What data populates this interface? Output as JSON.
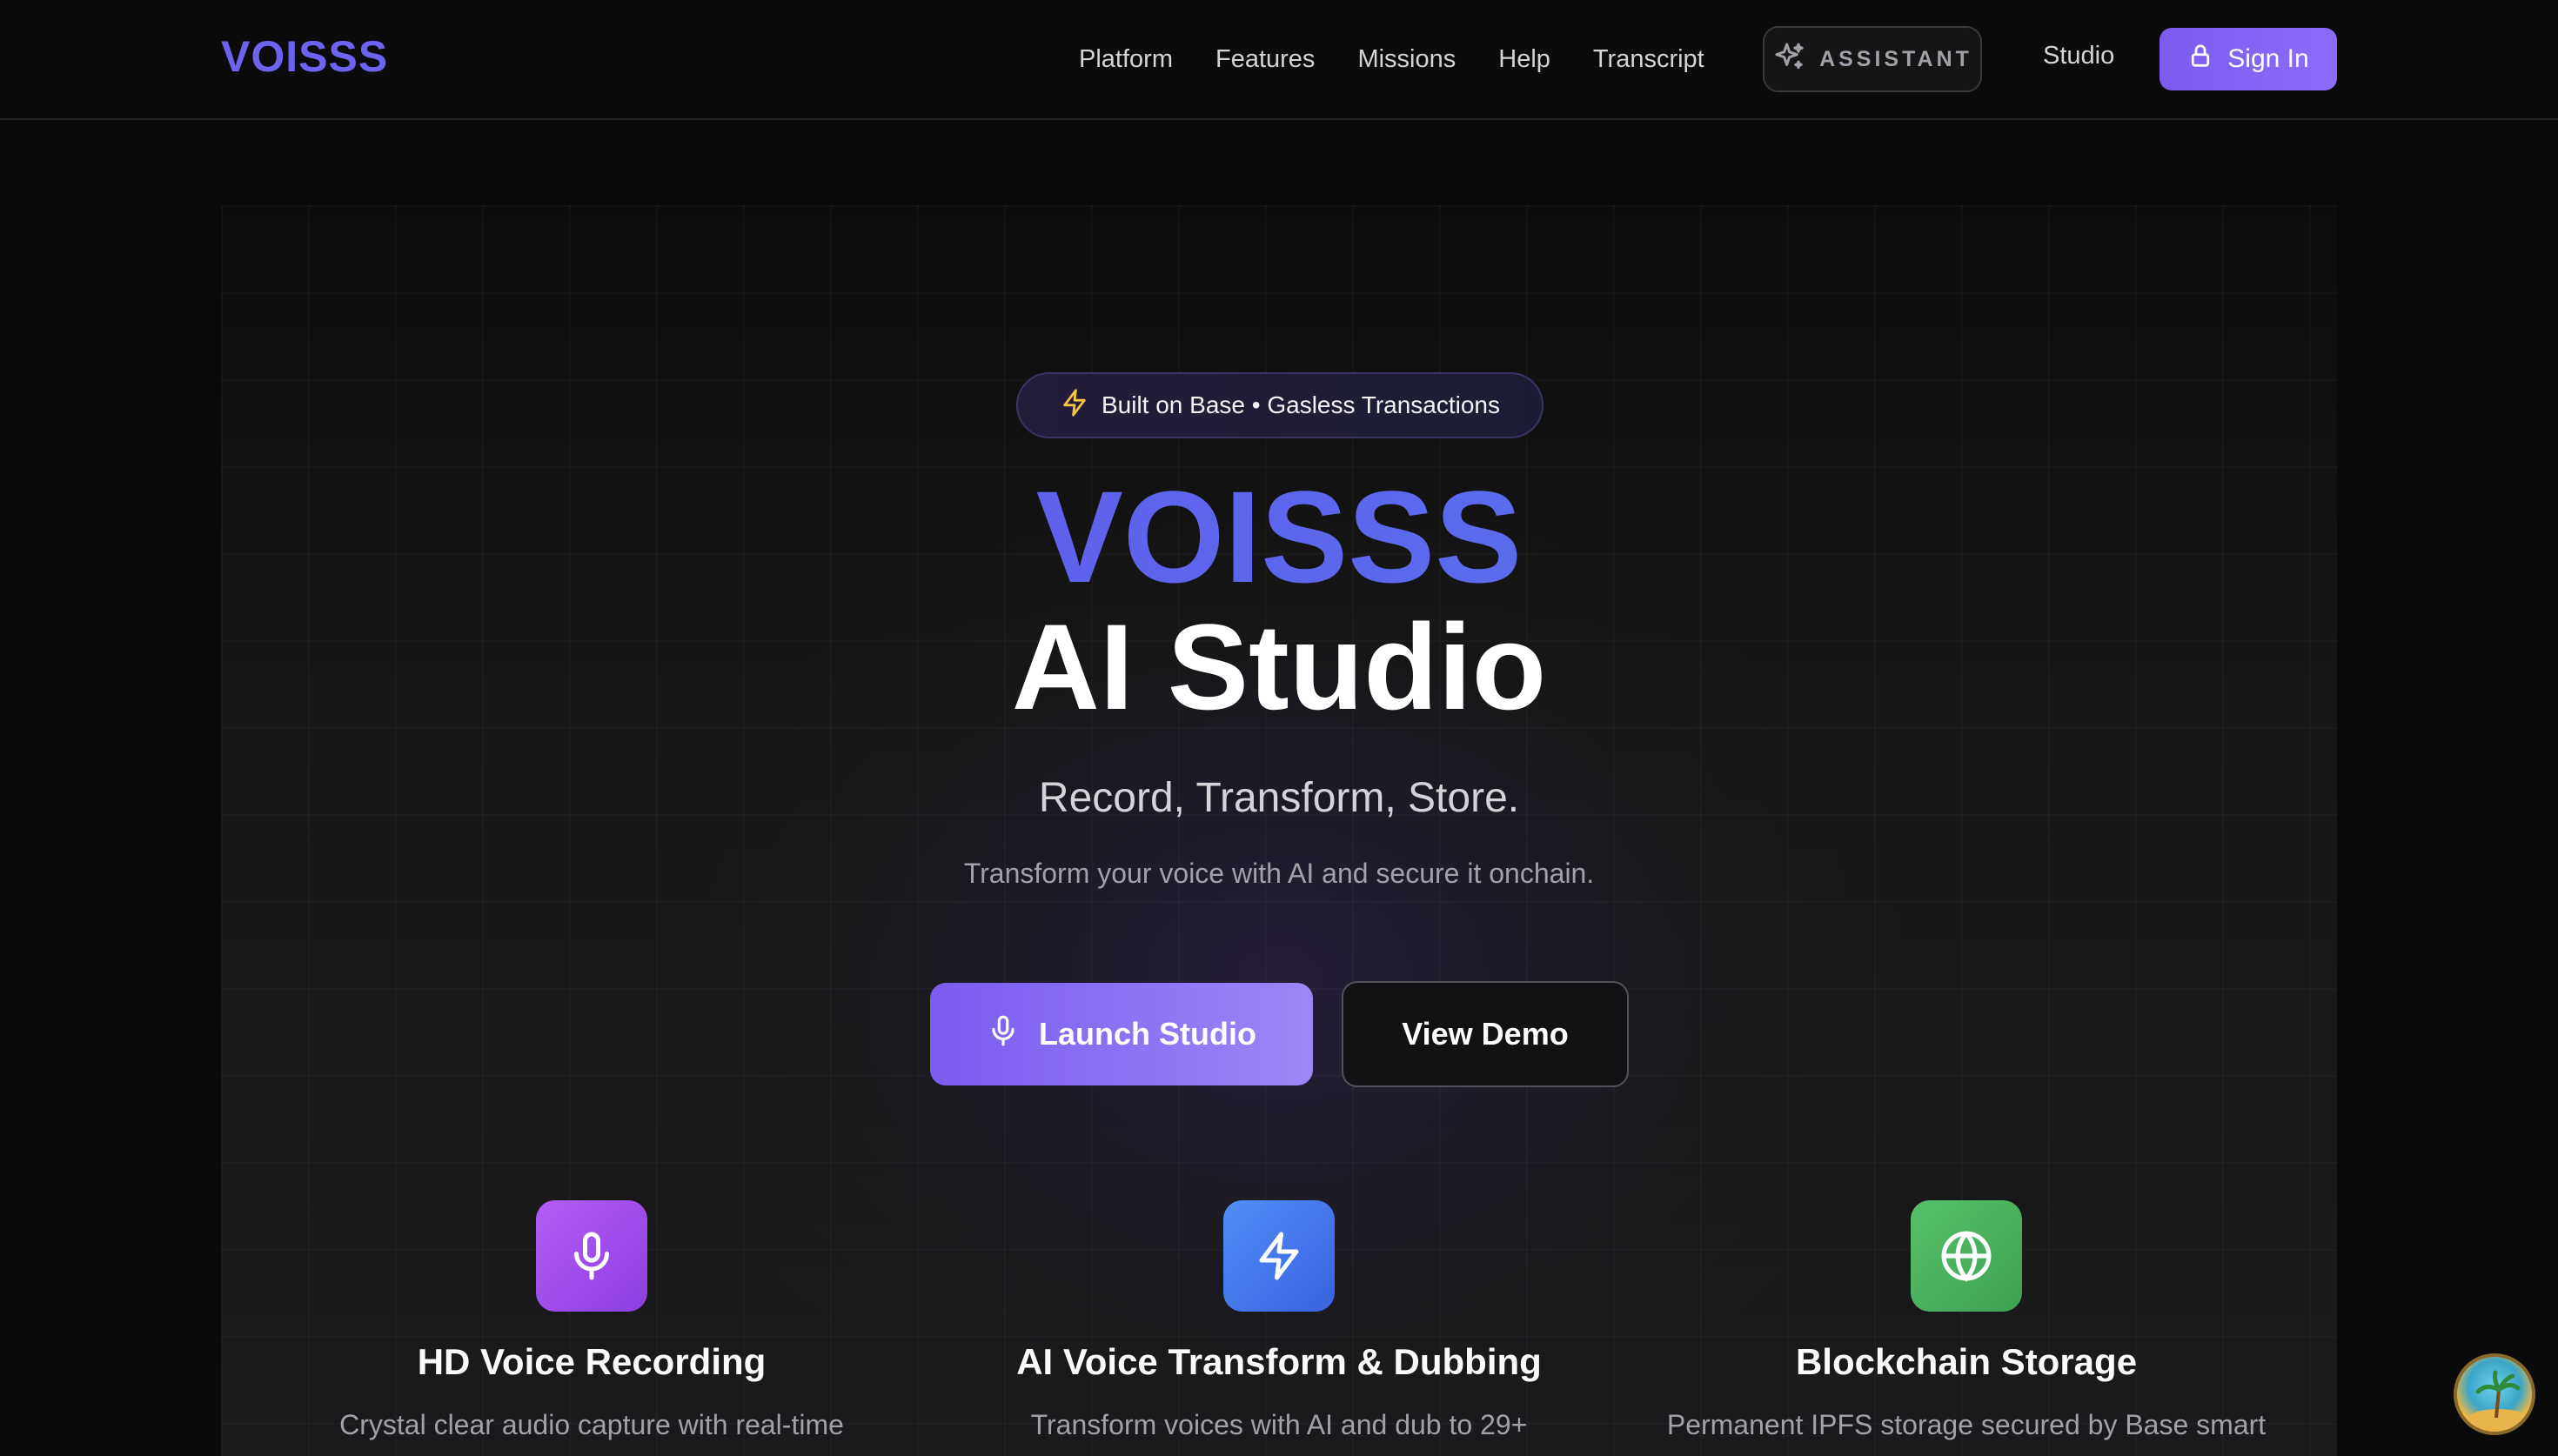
{
  "nav": {
    "logo": "VOISSS",
    "links": [
      "Platform",
      "Features",
      "Missions",
      "Help",
      "Transcript"
    ],
    "assistant_label": "ASSISTANT",
    "studio_label": "Studio",
    "signin_label": "Sign In"
  },
  "hero": {
    "badge": "Built on Base • Gasless Transactions",
    "title_line1": "VOISSS",
    "title_line2": "AI Studio",
    "tagline": "Record, Transform, Store.",
    "subtagline": "Transform your voice with AI and secure it onchain.",
    "launch_label": "Launch Studio",
    "demo_label": "View Demo"
  },
  "features": [
    {
      "icon": "microphone-icon",
      "title": "HD Voice Recording",
      "desc": "Crystal clear audio capture with real-time"
    },
    {
      "icon": "lightning-icon",
      "title": "AI Voice Transform & Dubbing",
      "desc": "Transform voices with AI and dub to 29+"
    },
    {
      "icon": "globe-icon",
      "title": "Blockchain Storage",
      "desc": "Permanent IPFS storage secured by Base smart"
    }
  ],
  "colors": {
    "accent": "#7c5cf0",
    "logo": "#6d63f0",
    "gradient_start": "#6a4ff0",
    "gradient_end": "#4f7de8"
  }
}
